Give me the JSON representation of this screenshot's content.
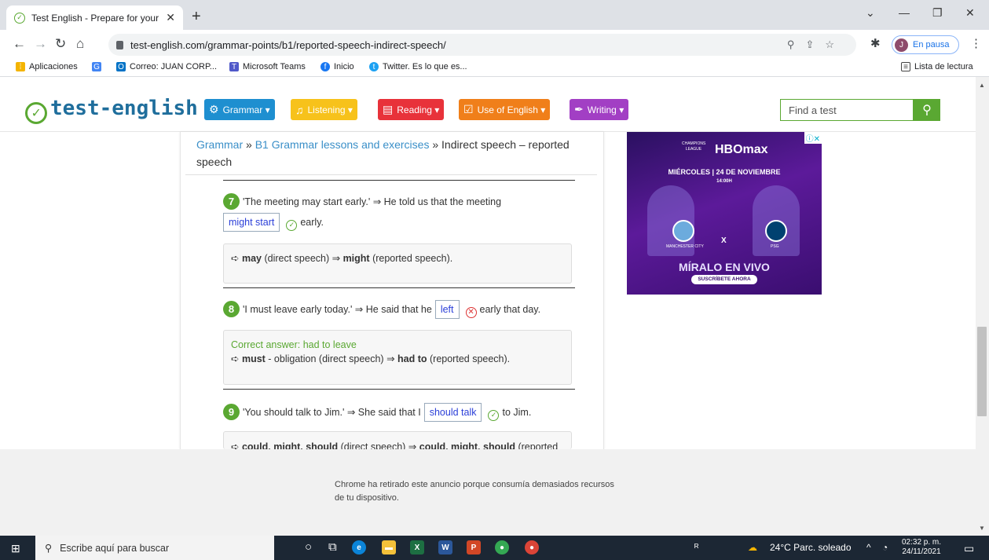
{
  "browser": {
    "tab_title": "Test English - Prepare for your En",
    "tab_close": "✕",
    "new_tab": "+",
    "url": "test-english.com/grammar-points/b1/reported-speech-indirect-speech/",
    "profile_initial": "J",
    "profile_status": "En pausa",
    "bookmarks": [
      {
        "label": "Aplicaciones",
        "icon": "apps-grid-icon",
        "color": "#f4b400"
      },
      {
        "label": "",
        "icon": "google-icon",
        "color": "#4285f4"
      },
      {
        "label": "Correo: JUAN CORP...",
        "icon": "outlook-icon",
        "color": "#0072c6"
      },
      {
        "label": "Microsoft Teams",
        "icon": "teams-icon",
        "color": "#5059c9"
      },
      {
        "label": "Inicio",
        "icon": "facebook-icon",
        "color": "#1877f2"
      },
      {
        "label": "Twitter. Es lo que es...",
        "icon": "twitter-icon",
        "color": "#1da1f2"
      }
    ],
    "reading_list": "Lista de lectura"
  },
  "site": {
    "logo": "test-english",
    "menu": [
      {
        "label": "Grammar",
        "icon": "gear-icon",
        "color": "#1e8fd0"
      },
      {
        "label": "Listening",
        "icon": "headphones-icon",
        "color": "#f7c21b"
      },
      {
        "label": "Reading",
        "icon": "document-icon",
        "color": "#e8323a"
      },
      {
        "label": "Use of English",
        "icon": "checkbox-icon",
        "color": "#f07f1a"
      },
      {
        "label": "Writing",
        "icon": "pen-icon",
        "color": "#a23fc4"
      }
    ],
    "search_placeholder": "Find a test"
  },
  "breadcrumb": {
    "part1": "Grammar",
    "sep": " » ",
    "part2": "B1 Grammar lessons and exercises",
    "part3": "Indirect speech – reported speech"
  },
  "questions": [
    {
      "number": "7",
      "before": "'The meeting may start early.' ⇒ He told us that the meeting",
      "answer": "might start",
      "after": "early.",
      "correct": true,
      "explanation_lead": "➪ ",
      "explanation_b1": "may",
      "explanation_mid": " (direct speech) ⇒ ",
      "explanation_b2": "might",
      "explanation_end": " (reported speech)."
    },
    {
      "number": "8",
      "before": "'I must leave early today.' ⇒ He said that he",
      "answer": "left",
      "after": "early that day.",
      "correct": false,
      "correct_answer": "Correct answer: had to leave",
      "explanation_lead": "➪ ",
      "explanation_b1": "must",
      "explanation_mid": " - obligation (direct speech) ⇒ ",
      "explanation_b2": "had to",
      "explanation_end": " (reported speech)."
    },
    {
      "number": "9",
      "before": "'You should talk to Jim.' ⇒ She said that I",
      "answer": "should talk",
      "after": "to Jim.",
      "correct": true,
      "explanation_lead": "➪ ",
      "explanation_b1": "could, might, should",
      "explanation_mid": " (direct speech) ⇒ ",
      "explanation_b2": "could, might, should",
      "explanation_end": " (reported"
    }
  ],
  "ad": {
    "league": "CHAMPIONS LEAGUE",
    "brand": "HBOmax",
    "date": "MIÉRCOLES | 24 DE NOVIEMBRE",
    "time": "14:00H",
    "team1": "MANCHESTER CITY",
    "team2": "PSG",
    "vs": "X",
    "cta": "MÍRALO EN VIVO",
    "subscribe": "SUSCRÍBETE AHORA"
  },
  "removed_ad_text": "Chrome ha retirado este anuncio porque consumía demasiados recursos de tu dispositivo.",
  "taskbar": {
    "search_placeholder": "Escribe aquí para buscar",
    "weather": "24°C  Parc. soleado",
    "time": "02:32 p. m.",
    "date": "24/11/2021"
  }
}
